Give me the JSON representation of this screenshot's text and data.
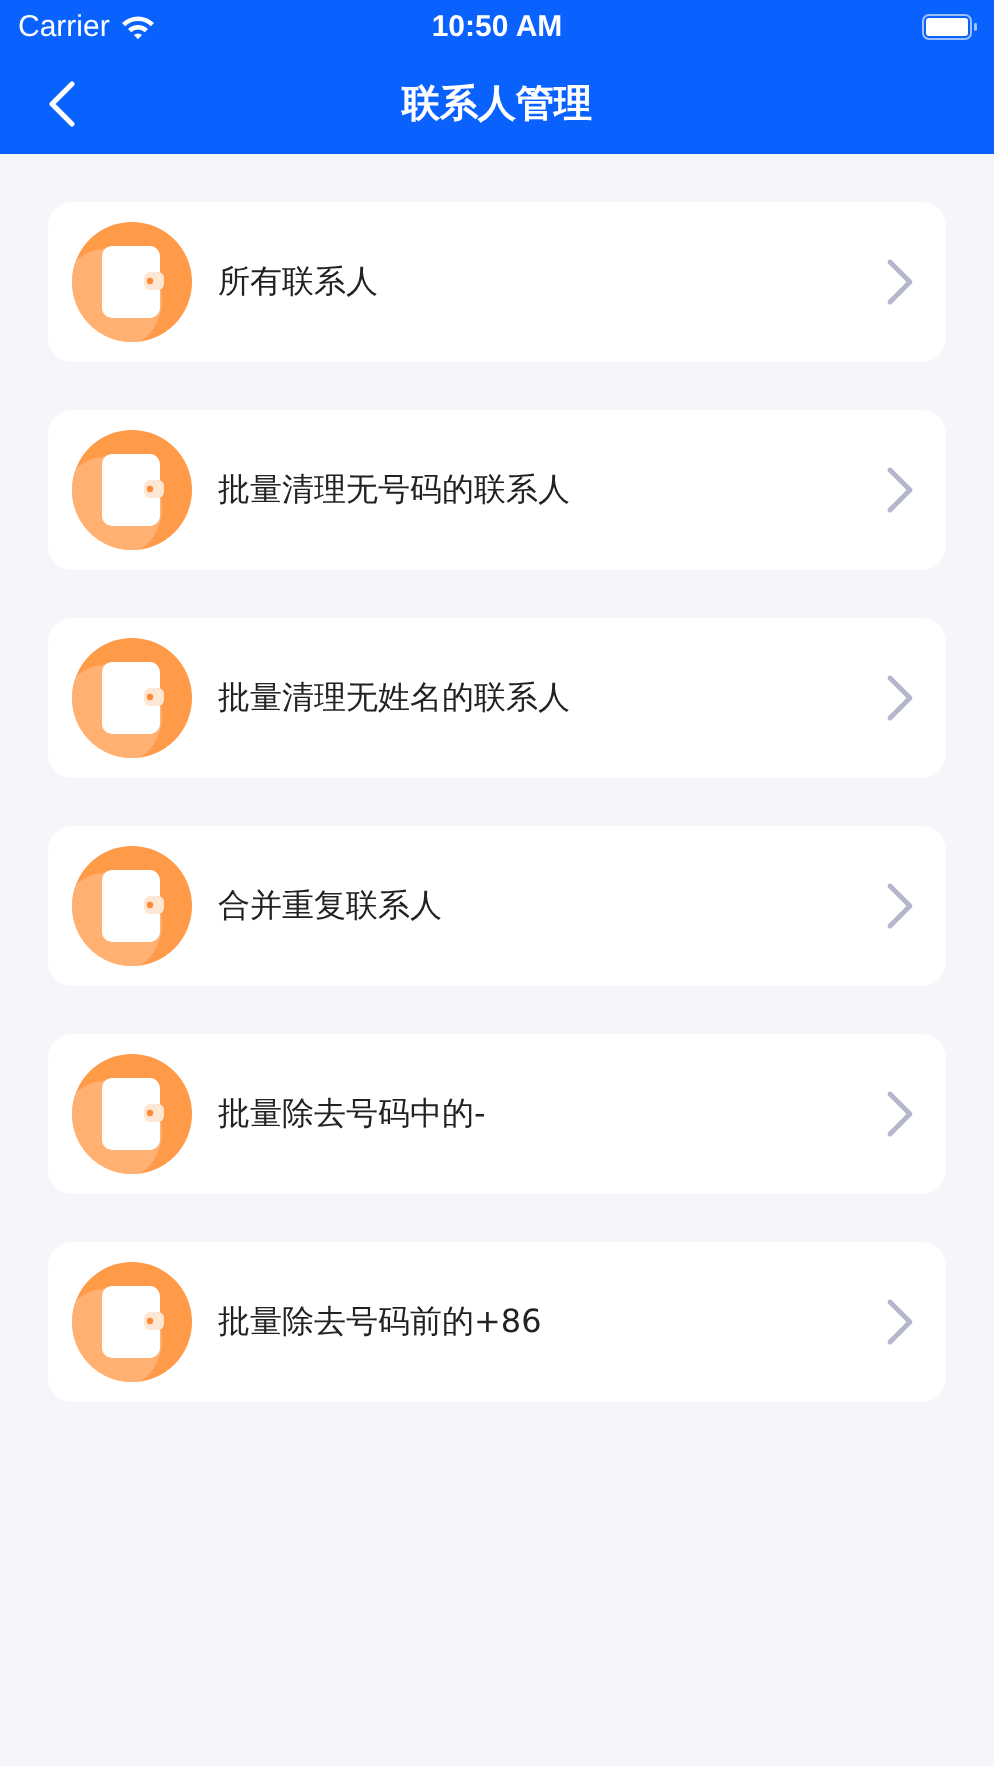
{
  "status_bar": {
    "carrier": "Carrier",
    "time": "10:50 AM"
  },
  "nav_bar": {
    "title": "联系人管理"
  },
  "menu_items": [
    {
      "label": "所有联系人"
    },
    {
      "label": "批量清理无号码的联系人"
    },
    {
      "label": "批量清理无姓名的联系人"
    },
    {
      "label": "合并重复联系人"
    },
    {
      "label": "批量除去号码中的-"
    },
    {
      "label": "批量除去号码前的+86"
    }
  ]
}
